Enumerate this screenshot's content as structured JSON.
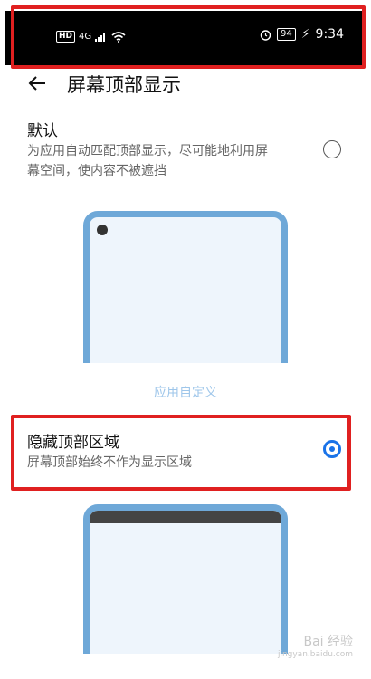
{
  "status_bar": {
    "left_label": "HD",
    "network": "4G",
    "battery": "94",
    "time": "9:34"
  },
  "header": {
    "title": "屏幕顶部显示"
  },
  "options": [
    {
      "title": "默认",
      "desc_line1": "为应用自动匹配顶部显示，尽可能地利用屏",
      "desc_line2": "幕空间，使内容不被遮挡",
      "selected": false
    },
    {
      "title": "隐藏顶部区域",
      "desc": "屏幕顶部始终不作为显示区域",
      "selected": true
    }
  ],
  "section_label": "应用自定义",
  "watermark": {
    "main": "Bai 经验",
    "sub": "jingyan.baidu.com"
  },
  "colors": {
    "accent": "#1a73e8",
    "highlight": "#e02020",
    "phone_frame": "#6ea8d8"
  }
}
